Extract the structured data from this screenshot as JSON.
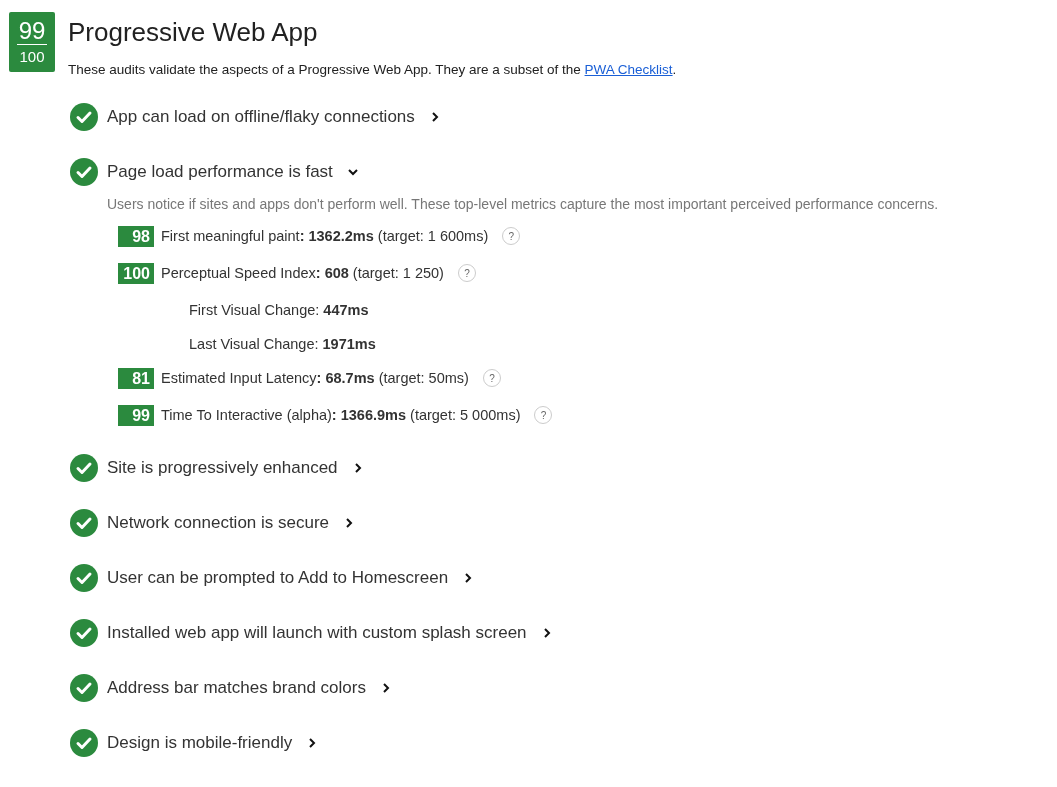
{
  "score": {
    "value": "99",
    "max": "100"
  },
  "title": "Progressive Web App",
  "description": {
    "text": "These audits validate the aspects of a Progressive Web App. They are a subset of the ",
    "link": "PWA Checklist",
    "end": "."
  },
  "audits": [
    {
      "label": "App can load on offline/flaky connections",
      "passed": true,
      "expanded": false
    },
    {
      "label": "Page load performance is fast",
      "passed": true,
      "expanded": true,
      "description": "Users notice if sites and apps don't perform well. These top-level metrics capture the most important perceived performance concerns.",
      "metrics": [
        {
          "kind": "scored",
          "score": "98",
          "text": "First meaningful paint**: 1362.2ms** (target: 1 600ms)",
          "help": "?"
        },
        {
          "kind": "scored",
          "score": "100",
          "text": "Perceptual Speed Index**: 608** (target: 1 250)",
          "help": "?"
        },
        {
          "kind": "sub",
          "text": "First Visual Change: **447ms**"
        },
        {
          "kind": "sub",
          "text": "Last Visual Change: **1971ms**"
        },
        {
          "kind": "scored",
          "score": "81",
          "text": "Estimated Input Latency**: 68.7ms** (target: 50ms)",
          "help": "?"
        },
        {
          "kind": "scored",
          "score": "99",
          "text": "Time To Interactive (alpha)**: 1366.9ms** (target: 5 000ms)",
          "help": "?"
        }
      ]
    },
    {
      "label": "Site is progressively enhanced",
      "passed": true,
      "expanded": false
    },
    {
      "label": "Network connection is secure",
      "passed": true,
      "expanded": false
    },
    {
      "label": "User can be prompted to Add to Homescreen",
      "passed": true,
      "expanded": false
    },
    {
      "label": "Installed web app will launch with custom splash screen",
      "passed": true,
      "expanded": false
    },
    {
      "label": "Address bar matches brand colors",
      "passed": true,
      "expanded": false
    },
    {
      "label": "Design is mobile-friendly",
      "passed": true,
      "expanded": false
    }
  ]
}
